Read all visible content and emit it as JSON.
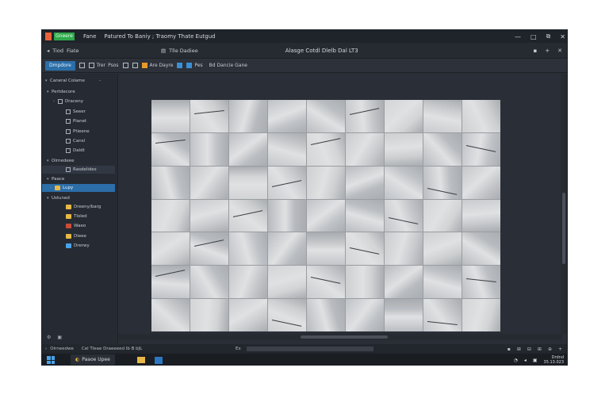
{
  "titlebar": {
    "app_label": "Gneere",
    "menu_file": "Fane",
    "title": "Patured To Baniy ; Traomy Thate Eutgud",
    "controls": [
      "—",
      "□",
      "⧉",
      "✕"
    ]
  },
  "toolbar1": {
    "btn1": "Tiod",
    "btn2": "Fiate",
    "doc_title": "Tlle Dadiee",
    "center_title": "Alasge Cotdl Dlelb Dal LT3",
    "right_icons": [
      "▪",
      "+",
      "✕"
    ]
  },
  "toolbar2": {
    "primary": "Dmpdore",
    "items": [
      "Trer",
      "Psos",
      "Are Dayre",
      "Pes",
      "Bd Dancie Gane"
    ]
  },
  "sidebar": {
    "header": "Caneral Colame",
    "sections": [
      {
        "label": "Pertdecore",
        "type": "section"
      },
      {
        "label": "Draceny",
        "type": "folder"
      },
      {
        "label": "Seeer",
        "type": "item"
      },
      {
        "label": "Pianet",
        "type": "item"
      },
      {
        "label": "Ptieene",
        "type": "item"
      },
      {
        "label": "Cansl",
        "type": "item"
      },
      {
        "label": "Daldt",
        "type": "item"
      },
      {
        "label": "Oirnedeee",
        "type": "section"
      },
      {
        "label": "Rasdelides",
        "type": "item"
      },
      {
        "label": "Paace",
        "type": "section"
      },
      {
        "label": "Lupy",
        "type": "selected"
      },
      {
        "label": "Ustuned",
        "type": "section"
      },
      {
        "label": "Dreeny/barg",
        "type": "item"
      },
      {
        "label": "Tloled",
        "type": "item"
      },
      {
        "label": "Waeo",
        "type": "item"
      },
      {
        "label": "Dieee",
        "type": "item"
      },
      {
        "label": "Drerwy",
        "type": "item"
      }
    ]
  },
  "statusbar": {
    "left": "Oirneedwe",
    "left2": "Cel Tleae Draeeeed Ib B bJL",
    "mid": "Ex",
    "right": [
      "▪",
      "⊞",
      "⊟",
      "⊞",
      "⊕",
      "+"
    ]
  },
  "taskbar": {
    "app": "Paaoe Upee",
    "clock_top": "Drdnd",
    "clock_bottom": "35.13.023"
  },
  "colors": {
    "accent": "#2b6ea8",
    "window_bg": "#2a2f37",
    "tile_base": "#c7c9cc"
  }
}
